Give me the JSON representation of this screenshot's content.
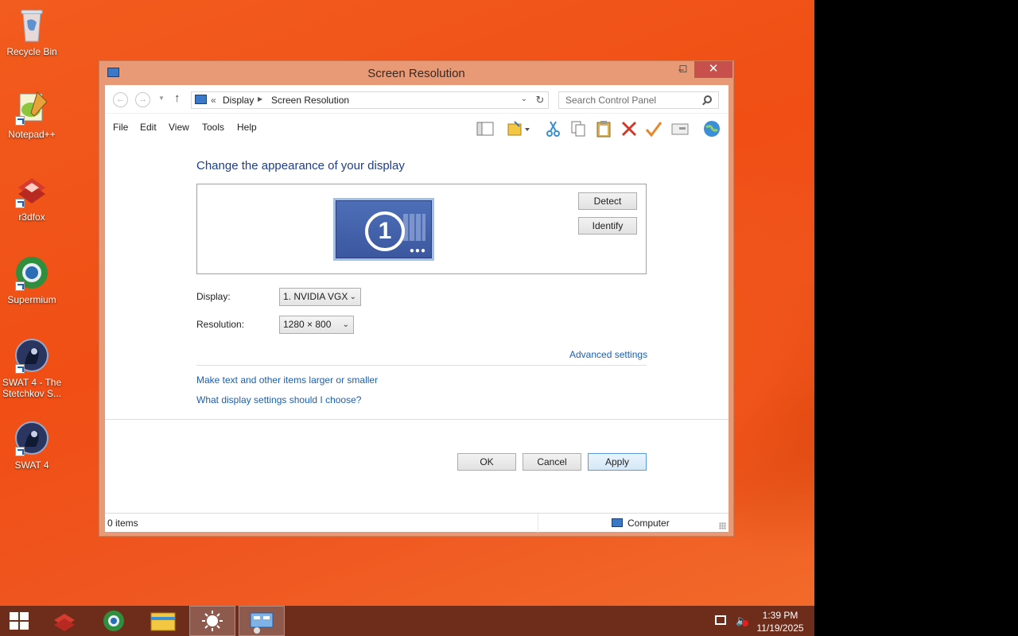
{
  "desktop": {
    "icons": [
      {
        "label": "Recycle Bin"
      },
      {
        "label": "Notepad++"
      },
      {
        "label": "r3dfox"
      },
      {
        "label": "Supermium"
      },
      {
        "label": "SWAT 4 - The Stetchkov S..."
      },
      {
        "label": "SWAT 4"
      }
    ]
  },
  "window": {
    "title": "Screen Resolution",
    "controls": {
      "minimize": "‒",
      "maximize": "☐",
      "close": "✕"
    },
    "address": {
      "chevron": "«",
      "crumbs": [
        "Display",
        "Screen Resolution"
      ]
    },
    "search": {
      "placeholder": "Search Control Panel"
    },
    "menu": [
      "File",
      "Edit",
      "View",
      "Tools",
      "Help"
    ],
    "toolbar_icons": [
      "layout-icon",
      "folder-icon",
      "cut-icon",
      "copy-icon",
      "paste-icon",
      "delete-icon",
      "checkmark-icon",
      "properties-icon",
      "globe-icon"
    ],
    "content": {
      "heading": "Change the appearance of your display",
      "monitor_number": "1",
      "detect_label": "Detect",
      "identify_label": "Identify",
      "display_label": "Display:",
      "display_value": "1. NVIDIA VGX",
      "resolution_label": "Resolution:",
      "resolution_value": "1280 × 800",
      "advanced_link": "Advanced settings",
      "links": [
        "Make text and other items larger or smaller",
        "What display settings should I choose?"
      ],
      "ok_label": "OK",
      "cancel_label": "Cancel",
      "apply_label": "Apply"
    },
    "status": {
      "items": "0 items",
      "location": "Computer"
    }
  },
  "taskbar": {
    "apps": [
      "r3dfox",
      "Supermium",
      "File Explorer",
      "Display Settings",
      "Control Panel"
    ],
    "clock_time": "1:39 PM",
    "clock_date": "11/19/2025"
  },
  "colors": {
    "desktop_orange": "#f0541a",
    "taskbar": "#6e2c1b",
    "window_frame": "#e89a76",
    "close_button": "#c7504d",
    "link_blue": "#1a5fb4",
    "heading_blue": "#1e3e8c"
  }
}
